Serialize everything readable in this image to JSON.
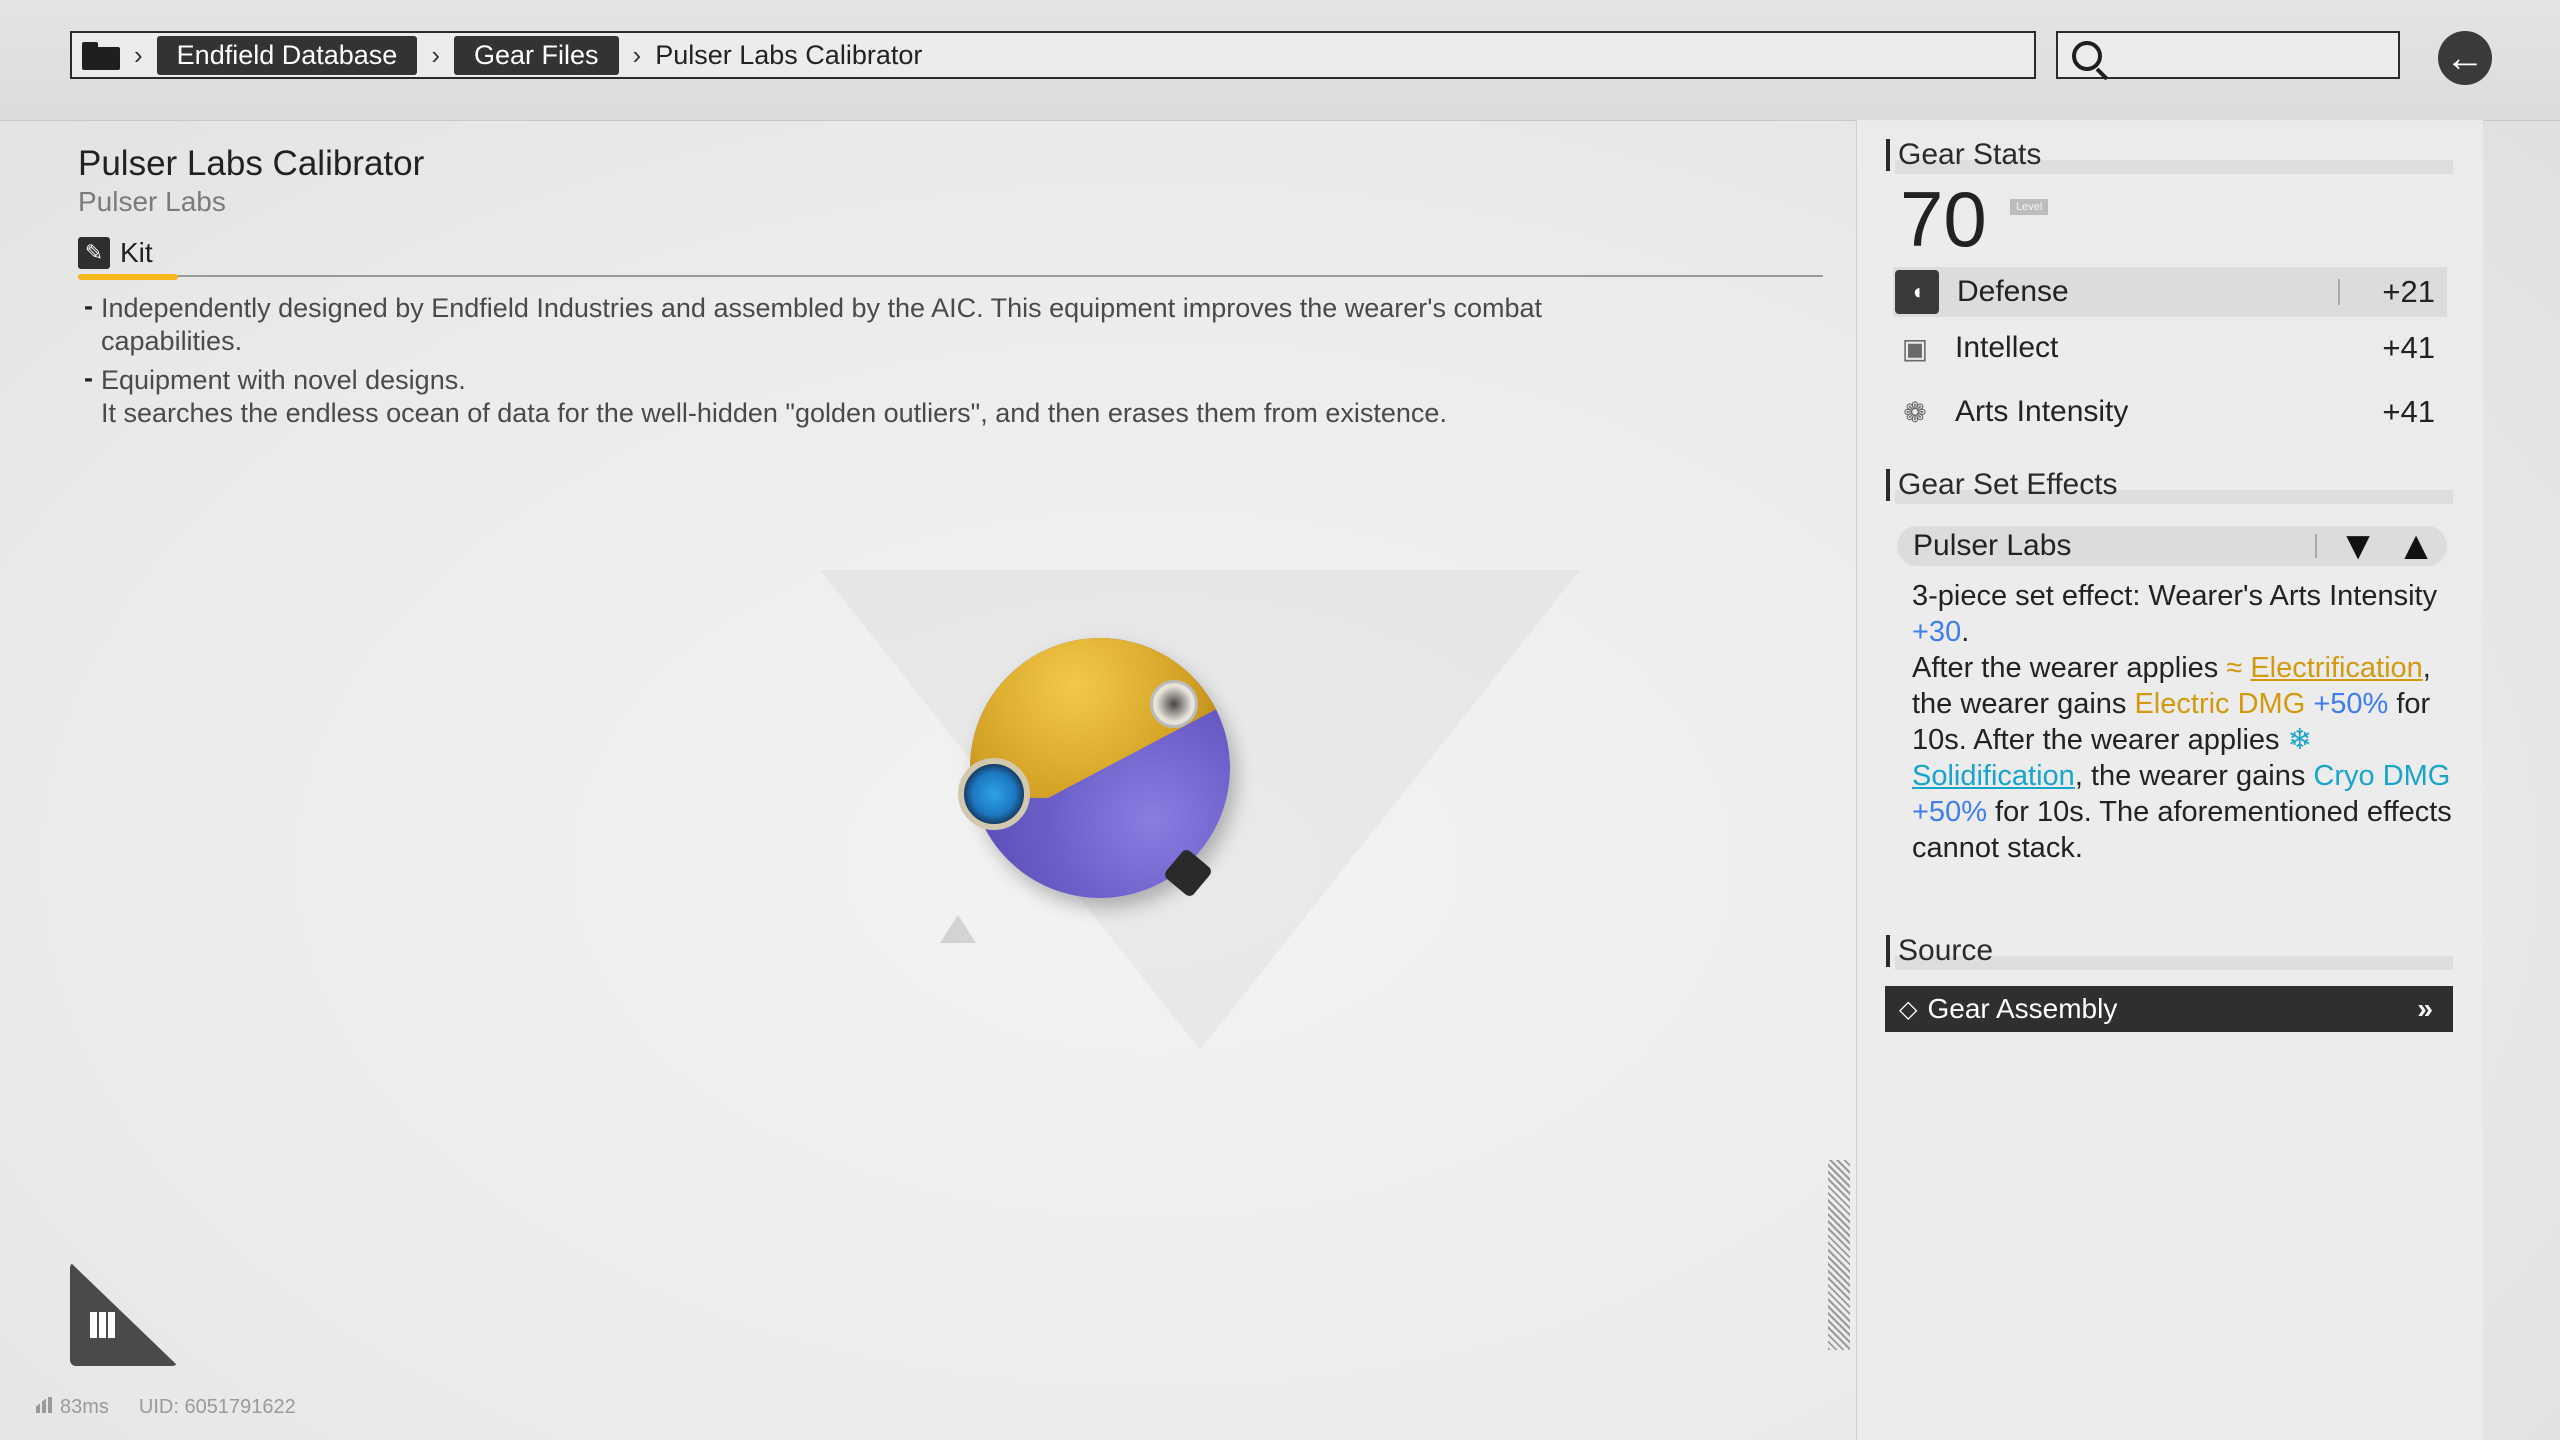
{
  "breadcrumb": {
    "items": [
      "Endfield Database",
      "Gear Files",
      "Pulser Labs Calibrator"
    ]
  },
  "search": {
    "placeholder": ""
  },
  "item": {
    "title": "Pulser Labs Calibrator",
    "subtitle": "Pulser Labs",
    "tab_label": "Kit",
    "description": [
      "Independently designed by Endfield Industries and assembled by the AIC. This equipment improves the wearer's combat capabilities.",
      "Equipment with novel designs.\nIt searches the endless ocean of data for the well-hidden \"golden outliers\", and then erases them from existence."
    ]
  },
  "stats": {
    "title": "Gear Stats",
    "level": "70",
    "level_tag": "Level",
    "rows": [
      {
        "name": "Defense",
        "value": "+21",
        "icon": "shield-icon"
      },
      {
        "name": "Intellect",
        "value": "+41",
        "icon": "intellect-icon"
      },
      {
        "name": "Arts Intensity",
        "value": "+41",
        "icon": "arts-icon"
      }
    ]
  },
  "set_effects": {
    "title": "Gear Set Effects",
    "name": "Pulser Labs",
    "text": {
      "p1": "3-piece set effect: Wearer's Arts Intensity ",
      "p1_val": "+30",
      "p1_end": ".",
      "p2": "After the wearer applies ",
      "electrification": "Electrification",
      "p3": ", the wearer gains ",
      "electric_dmg": "Electric DMG",
      "electric_val": "+50%",
      "p4": " for 10s. After the wearer applies ",
      "solidification": "Solidification",
      "p5": ", the wearer gains ",
      "cryo_dmg": "Cryo DMG",
      "cryo_val": "+50%",
      "p6": " for 10s. The aforementioned effects cannot stack."
    }
  },
  "source": {
    "title": "Source",
    "button_label": "Gear Assembly"
  },
  "footer": {
    "ping": "83ms",
    "uid": "UID: 6051791622"
  },
  "colors": {
    "accent": "#f6b81b",
    "blue": "#3f7df2",
    "gold": "#d39a10",
    "cyan": "#18a4cc"
  }
}
